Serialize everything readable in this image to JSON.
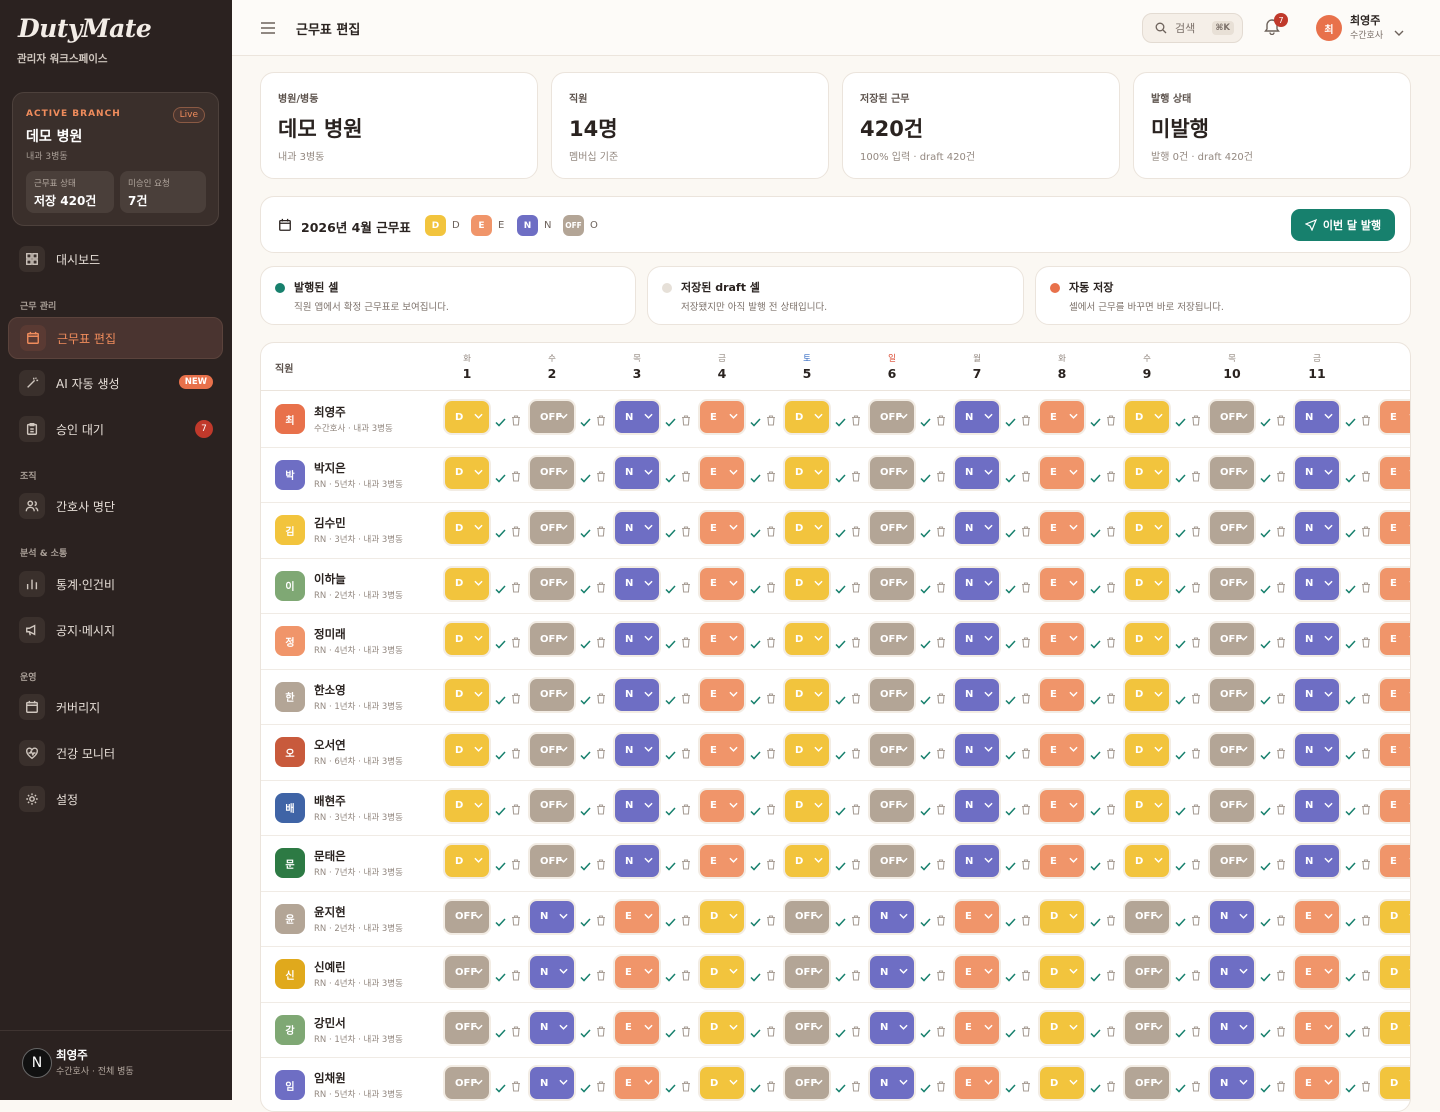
{
  "sidebar": {
    "logo": "DutyMate",
    "workspace": "관리자 워크스페이스",
    "branch": {
      "eyebrow": "ACTIVE BRANCH",
      "live": "Live",
      "name": "데모 병원",
      "sub": "내과 3병동",
      "stat1_label": "근무표 상태",
      "stat1_value": "저장 420건",
      "stat2_label": "미승인 요청",
      "stat2_value": "7건"
    },
    "sections": [
      "근무 관리",
      "조직",
      "분석 & 소통",
      "운영"
    ],
    "items": [
      {
        "label": "대시보드",
        "icon": "dashboard-icon"
      },
      {
        "label": "근무표 편집",
        "icon": "calendar-icon",
        "active": true
      },
      {
        "label": "AI 자동 생성",
        "icon": "magic-wand-icon",
        "badge": "NEW"
      },
      {
        "label": "승인 대기",
        "icon": "clipboard-icon",
        "badge": "7"
      },
      {
        "label": "간호사 명단",
        "icon": "users-icon"
      },
      {
        "label": "통계·인건비",
        "icon": "bar-chart-icon"
      },
      {
        "label": "공지·메시지",
        "icon": "megaphone-icon"
      },
      {
        "label": "커버리지",
        "icon": "calendar-check-icon"
      },
      {
        "label": "건강 모니터",
        "icon": "heart-pulse-icon"
      },
      {
        "label": "설정",
        "icon": "gear-icon"
      }
    ],
    "user": {
      "initial": "N",
      "name": "최영주",
      "role": "수간호사 · 전체 병동"
    }
  },
  "topbar": {
    "title": "근무표 편집",
    "search_placeholder": "검색",
    "search_kbd": "⌘K",
    "notif_count": "7",
    "user_initial": "최",
    "user_name": "최영주",
    "user_role": "수간호사"
  },
  "cards": [
    {
      "label": "병원/병동",
      "value": "데모 병원",
      "sub": "내과 3병동"
    },
    {
      "label": "직원",
      "value": "14명",
      "sub": "멤버십 기준"
    },
    {
      "label": "저장된 근무",
      "value": "420건",
      "sub": "100% 입력 · draft 420건"
    },
    {
      "label": "발행 상태",
      "value": "미발행",
      "sub": "발행 0건 · draft 420건"
    }
  ],
  "legend": {
    "month": "2026년 4월 근무표",
    "items": [
      {
        "code": "D",
        "label": "D",
        "color": "#f2c43d"
      },
      {
        "code": "E",
        "label": "E",
        "color": "#f0956a"
      },
      {
        "code": "N",
        "label": "N",
        "color": "#6e6ec4"
      },
      {
        "code": "OFF",
        "label": "O",
        "color": "#b3a596"
      }
    ],
    "publish_button": "이번 달 발행"
  },
  "info": [
    {
      "title": "발행된 셀",
      "desc": "직원 앱에서 확정 근무표로 보여집니다.",
      "color": "#17806d"
    },
    {
      "title": "저장된 draft 셀",
      "desc": "저장됐지만 아직 발행 전 상태입니다.",
      "color": "#e6e0d8"
    },
    {
      "title": "자동 저장",
      "desc": "셀에서 근무를 바꾸면 바로 저장됩니다.",
      "color": "#e8714b"
    }
  ],
  "grid": {
    "staff_header": "직원",
    "days": [
      {
        "w": "화",
        "n": "1"
      },
      {
        "w": "수",
        "n": "2"
      },
      {
        "w": "목",
        "n": "3"
      },
      {
        "w": "금",
        "n": "4"
      },
      {
        "w": "토",
        "n": "5",
        "color": "#3b6fc4"
      },
      {
        "w": "일",
        "n": "6",
        "color": "#d9442b"
      },
      {
        "w": "월",
        "n": "7"
      },
      {
        "w": "화",
        "n": "8"
      },
      {
        "w": "수",
        "n": "9"
      },
      {
        "w": "목",
        "n": "10"
      },
      {
        "w": "금",
        "n": "11"
      }
    ],
    "rows": [
      {
        "initial": "최",
        "name": "최영주",
        "role": "수간호사 · 내과 3병동",
        "color": "#e8714b",
        "shifts": [
          "D",
          "OFF",
          "N",
          "E",
          "D",
          "OFF",
          "N",
          "E",
          "D",
          "OFF",
          "N",
          "E"
        ]
      },
      {
        "initial": "박",
        "name": "박지은",
        "role": "RN · 5년차 · 내과 3병동",
        "color": "#6e6ec4",
        "shifts": [
          "D",
          "OFF",
          "N",
          "E",
          "D",
          "OFF",
          "N",
          "E",
          "D",
          "OFF",
          "N",
          "E"
        ]
      },
      {
        "initial": "김",
        "name": "김수민",
        "role": "RN · 3년차 · 내과 3병동",
        "color": "#f2c43d",
        "shifts": [
          "D",
          "OFF",
          "N",
          "E",
          "D",
          "OFF",
          "N",
          "E",
          "D",
          "OFF",
          "N",
          "E"
        ]
      },
      {
        "initial": "이",
        "name": "이하늘",
        "role": "RN · 2년차 · 내과 3병동",
        "color": "#7fa874",
        "shifts": [
          "D",
          "OFF",
          "N",
          "E",
          "D",
          "OFF",
          "N",
          "E",
          "D",
          "OFF",
          "N",
          "E"
        ]
      },
      {
        "initial": "정",
        "name": "정미래",
        "role": "RN · 4년차 · 내과 3병동",
        "color": "#f0956a",
        "shifts": [
          "D",
          "OFF",
          "N",
          "E",
          "D",
          "OFF",
          "N",
          "E",
          "D",
          "OFF",
          "N",
          "E"
        ]
      },
      {
        "initial": "한",
        "name": "한소영",
        "role": "RN · 1년차 · 내과 3병동",
        "color": "#b3a596",
        "shifts": [
          "D",
          "OFF",
          "N",
          "E",
          "D",
          "OFF",
          "N",
          "E",
          "D",
          "OFF",
          "N",
          "E"
        ]
      },
      {
        "initial": "오",
        "name": "오서연",
        "role": "RN · 6년차 · 내과 3병동",
        "color": "#c85a3c",
        "shifts": [
          "D",
          "OFF",
          "N",
          "E",
          "D",
          "OFF",
          "N",
          "E",
          "D",
          "OFF",
          "N",
          "E"
        ]
      },
      {
        "initial": "배",
        "name": "배현주",
        "role": "RN · 3년차 · 내과 3병동",
        "color": "#3f64a6",
        "shifts": [
          "D",
          "OFF",
          "N",
          "E",
          "D",
          "OFF",
          "N",
          "E",
          "D",
          "OFF",
          "N",
          "E"
        ]
      },
      {
        "initial": "문",
        "name": "문태은",
        "role": "RN · 7년차 · 내과 3병동",
        "color": "#2d7a44",
        "shifts": [
          "D",
          "OFF",
          "N",
          "E",
          "D",
          "OFF",
          "N",
          "E",
          "D",
          "OFF",
          "N",
          "E"
        ]
      },
      {
        "initial": "윤",
        "name": "윤지현",
        "role": "RN · 2년차 · 내과 3병동",
        "color": "#b3a596",
        "shifts": [
          "OFF",
          "N",
          "E",
          "D",
          "OFF",
          "N",
          "E",
          "D",
          "OFF",
          "N",
          "E",
          "D"
        ]
      },
      {
        "initial": "신",
        "name": "신예린",
        "role": "RN · 4년차 · 내과 3병동",
        "color": "#e0a91c",
        "shifts": [
          "OFF",
          "N",
          "E",
          "D",
          "OFF",
          "N",
          "E",
          "D",
          "OFF",
          "N",
          "E",
          "D"
        ]
      },
      {
        "initial": "강",
        "name": "강민서",
        "role": "RN · 1년차 · 내과 3병동",
        "color": "#7fa874",
        "shifts": [
          "OFF",
          "N",
          "E",
          "D",
          "OFF",
          "N",
          "E",
          "D",
          "OFF",
          "N",
          "E",
          "D"
        ]
      },
      {
        "initial": "임",
        "name": "임채원",
        "role": "RN · 5년차 · 내과 3병동",
        "color": "#6e6ec4",
        "shifts": [
          "OFF",
          "N",
          "E",
          "D",
          "OFF",
          "N",
          "E",
          "D",
          "OFF",
          "N",
          "E",
          "D"
        ]
      }
    ]
  }
}
